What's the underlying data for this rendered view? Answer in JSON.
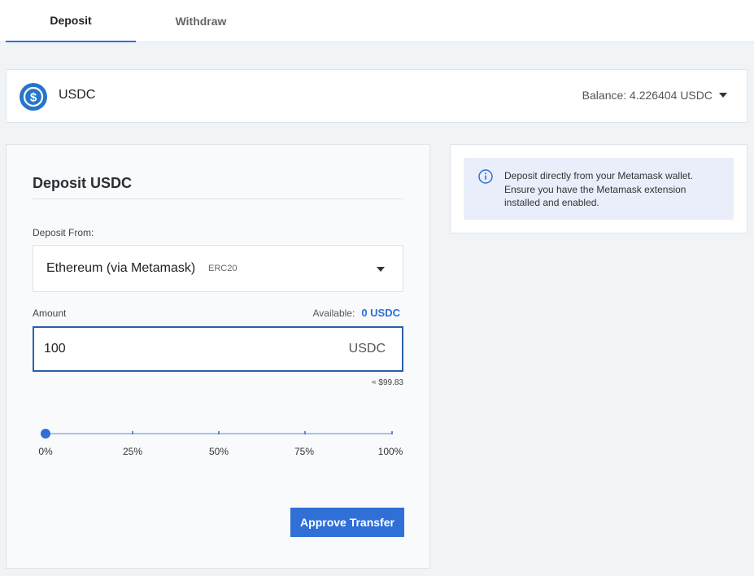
{
  "tabs": [
    {
      "label": "Deposit",
      "active": true
    },
    {
      "label": "Withdraw",
      "active": false
    }
  ],
  "asset": {
    "name": "USDC",
    "icon": "usdc-coin-icon",
    "balance": "Balance: 4.226404 USDC"
  },
  "deposit": {
    "title": "Deposit USDC",
    "from_label": "Deposit From:",
    "source": "Ethereum (via Metamask)",
    "source_tag": "ERC20",
    "amount_label": "Amount",
    "available_label": "Available:",
    "available_value": "0 USDC",
    "amount_value": "100",
    "amount_unit": "USDC",
    "usd_approx": "≈ $99.83",
    "slider": {
      "value_fraction": 0,
      "labels": [
        "0%",
        "25%",
        "50%",
        "75%",
        "100%"
      ]
    },
    "approve_label": "Approve Transfer"
  },
  "info": {
    "text": "Deposit directly from your Metamask wallet. Ensure you have the Metamask extension installed and enabled."
  },
  "colors": {
    "accent": "#2f6fd6",
    "background": "#f1f4f7",
    "info_bg": "#e9eefa"
  }
}
